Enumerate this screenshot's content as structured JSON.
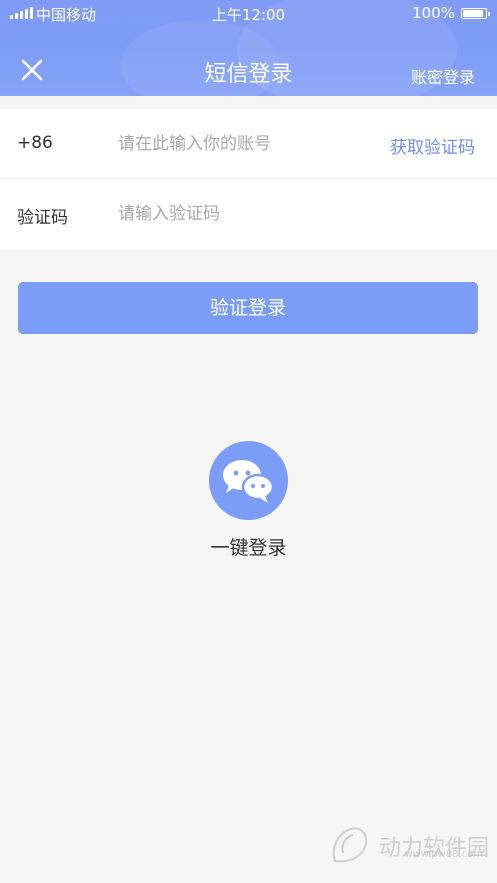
{
  "status_bar": {
    "carrier": "中国移动",
    "time": "上午12:00",
    "battery": "100%",
    "battery_level": 1.0
  },
  "nav": {
    "title": "短信登录",
    "right_link": "账密登录",
    "close_icon": "close-icon"
  },
  "form": {
    "country_code": "+86",
    "account_placeholder": "请在此输入你的账号",
    "get_code_label": "获取验证码",
    "code_label": "验证码",
    "code_placeholder": "请输入验证码"
  },
  "login_button": "验证登录",
  "one_click": {
    "icon": "wechat-icon",
    "label": "一键登录"
  },
  "watermark": {
    "text": "动力软件园",
    "url": "www.pw88.com"
  },
  "colors": {
    "accent": "#7b9cf7",
    "header": "#7e9cf6",
    "link": "#6f8df0",
    "background": "#f6f6f6"
  }
}
